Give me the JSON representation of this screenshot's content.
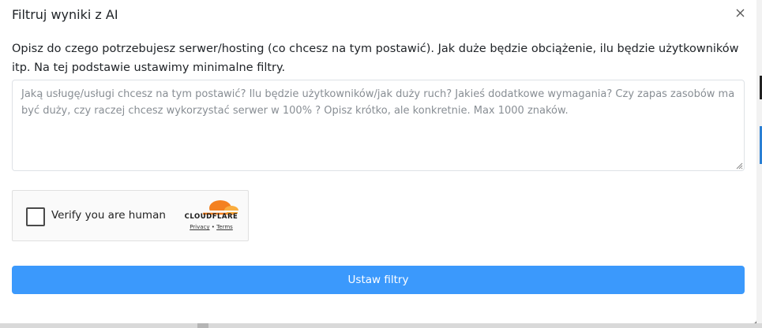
{
  "modal": {
    "title": "Filtruj wyniki z AI",
    "close_icon": "close-icon",
    "description": "Opisz do czego potrzebujesz serwer/hosting (co chcesz na tym postawić). Jak duże będzie obciążenie, ilu będzie użytkowników itp. Na tej podstawie ustawimy minimalne filtry.",
    "textarea": {
      "value": "",
      "placeholder": "Jaką usługę/usługi chcesz na tym postawić? Ilu będzie użytkowników/jak duży ruch? Jakieś dodatkowe wymagania? Czy zapas zasobów ma być duży, czy raczej chcesz wykorzystać serwer w 100% ? Opisz krótko, ale konkretnie. Max 1000 znaków."
    },
    "captcha": {
      "label": "Verify you are human",
      "brand": "CLOUDFLARE",
      "privacy": "Privacy",
      "separator": "•",
      "terms": "Terms",
      "checked": false
    },
    "submit_label": "Ustaw filtry",
    "accent_color": "#3b99fc"
  }
}
